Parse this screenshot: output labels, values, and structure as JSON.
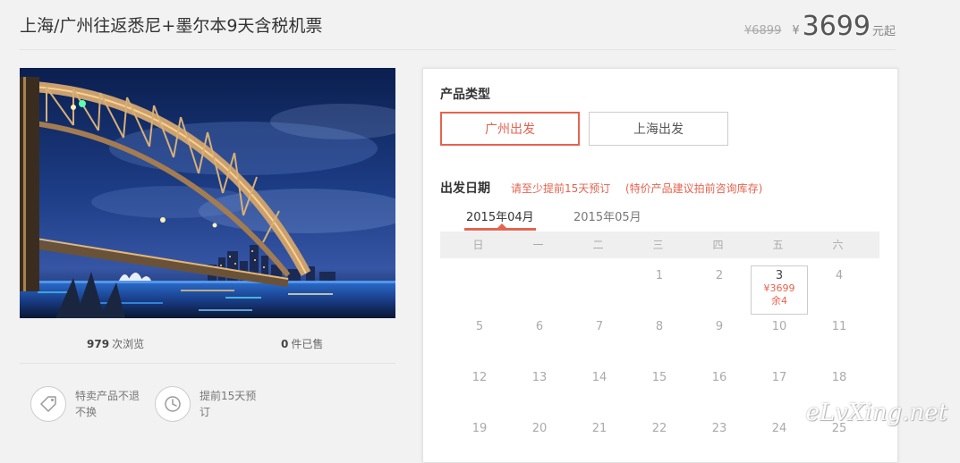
{
  "product": {
    "title": "上海/广州往返悉尼+墨尔本9天含税机票",
    "old_price": "¥6899",
    "currency": "¥",
    "price": "3699",
    "price_unit": "元起"
  },
  "stats": {
    "views_count": "979",
    "views_label": "次浏览",
    "sold_count": "0",
    "sold_label": "件已售"
  },
  "features": [
    {
      "icon": "tag-icon",
      "text": "特卖产品不退不换"
    },
    {
      "icon": "clock-icon",
      "text": "提前15天预订"
    }
  ],
  "booking": {
    "type_label": "产品类型",
    "types": [
      {
        "label": "广州出发",
        "active": true
      },
      {
        "label": "上海出发",
        "active": false
      }
    ],
    "date_label": "出发日期",
    "date_note1": "请至少提前15天预订",
    "date_note2": "(特价产品建议拍前咨询库存)",
    "months": [
      "2015年04月",
      "2015年05月"
    ],
    "weekdays": [
      "日",
      "一",
      "二",
      "三",
      "四",
      "五",
      "六"
    ],
    "calendar_rows": [
      [
        "",
        "",
        "",
        "1",
        "2",
        "3",
        "4"
      ],
      [
        "5",
        "6",
        "7",
        "8",
        "9",
        "10",
        "11"
      ],
      [
        "12",
        "13",
        "14",
        "15",
        "16",
        "17",
        "18"
      ],
      [
        "19",
        "20",
        "21",
        "22",
        "23",
        "24",
        "25"
      ]
    ],
    "selected_day": {
      "day": "3",
      "price": "¥3699",
      "remaining": "余4"
    }
  },
  "watermark": "eLvXing.net",
  "colors": {
    "accent": "#e6634f"
  }
}
